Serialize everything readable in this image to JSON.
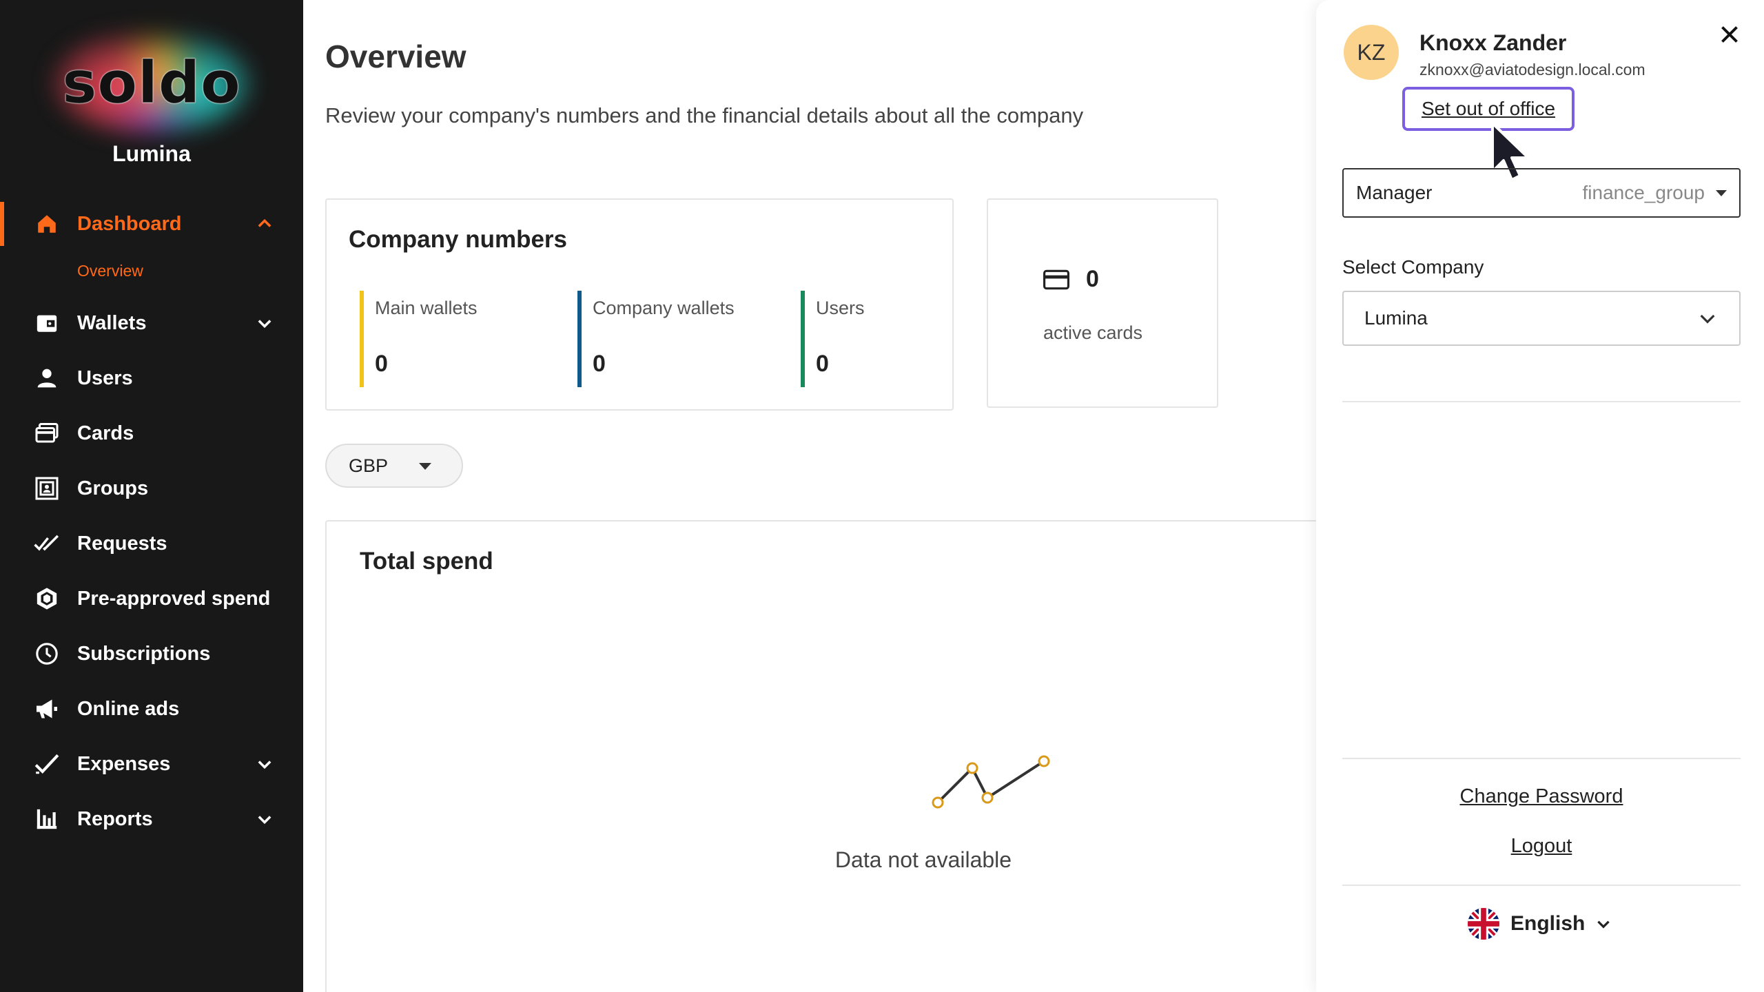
{
  "brand": {
    "logo_text": "soldo",
    "company": "Lumina"
  },
  "nav": {
    "dashboard": "Dashboard",
    "overview": "Overview",
    "wallets": "Wallets",
    "users": "Users",
    "cards": "Cards",
    "groups": "Groups",
    "requests": "Requests",
    "preapproved": "Pre-approved spend",
    "subscriptions": "Subscriptions",
    "online_ads": "Online ads",
    "expenses": "Expenses",
    "reports": "Reports"
  },
  "main": {
    "title": "Overview",
    "subtitle": "Review your company's numbers and the financial details about all the company",
    "company_numbers": {
      "title": "Company numbers",
      "metrics": [
        {
          "label": "Main wallets",
          "value": "0",
          "color": "#f2c318"
        },
        {
          "label": "Company wallets",
          "value": "0",
          "color": "#0f5a8c"
        },
        {
          "label": "Users",
          "value": "0",
          "color": "#1a8a5c"
        }
      ]
    },
    "active_cards": {
      "value": "0",
      "label": "active cards"
    },
    "currency": "GBP",
    "total_spend": {
      "title": "Total spend",
      "empty_text": "Data not available"
    }
  },
  "panel": {
    "initials": "KZ",
    "name": "Knoxx Zander",
    "email": "zknoxx@aviatodesign.local.com",
    "out_of_office": "Set out of office",
    "role": {
      "label": "Manager",
      "value": "finance_group"
    },
    "select_company_label": "Select Company",
    "selected_company": "Lumina",
    "change_password": "Change Password",
    "logout": "Logout",
    "language": "English"
  },
  "colors": {
    "accent": "#ff6a1a",
    "sidebar_bg": "#181818",
    "focus_ring": "#7b5fe0"
  }
}
